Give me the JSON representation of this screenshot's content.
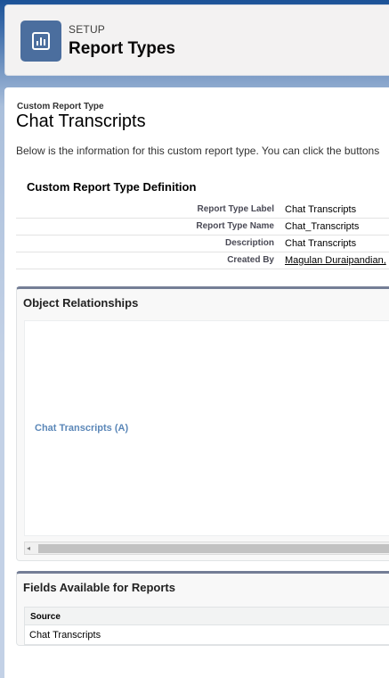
{
  "header": {
    "eyebrow": "SETUP",
    "title": "Report Types"
  },
  "crt": {
    "label": "Custom Report Type",
    "title": "Chat Transcripts",
    "intro": "Below is the information for this custom report type. You can click the buttons"
  },
  "definition": {
    "title": "Custom Report Type Definition",
    "rows": [
      {
        "label": "Report Type Label",
        "value": "Chat Transcripts"
      },
      {
        "label": "Report Type Name",
        "value": "Chat_Transcripts"
      },
      {
        "label": "Description",
        "value": "Chat Transcripts"
      },
      {
        "label": "Created By",
        "value": "Magulan Duraipandian,"
      }
    ]
  },
  "relationships": {
    "title": "Object Relationships",
    "object_a": "Chat Transcripts (A)"
  },
  "fields": {
    "title": "Fields Available for Reports",
    "column": "Source",
    "rows": [
      "Chat Transcripts"
    ]
  }
}
